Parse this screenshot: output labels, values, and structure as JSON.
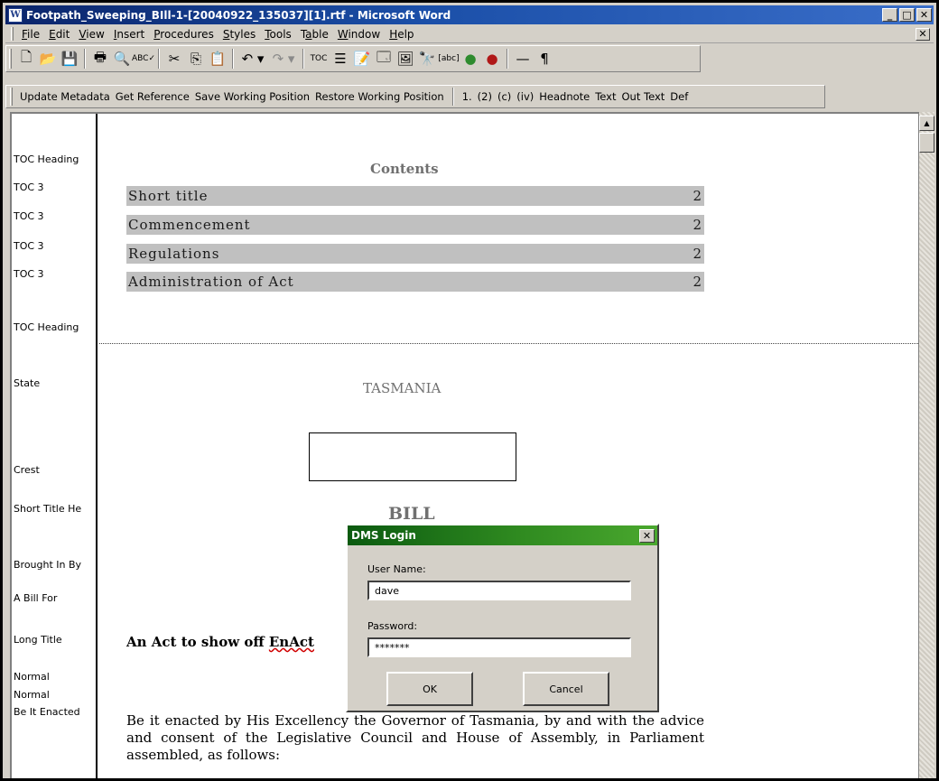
{
  "window": {
    "title": "Footpath_Sweeping_BIll-1-[20040922_135037][1].rtf - Microsoft Word",
    "app_icon": "W",
    "controls": {
      "minimize": "_",
      "maximize": "□",
      "close": "✕"
    },
    "doc_close": "✕"
  },
  "menu": [
    {
      "key": "F",
      "rest": "ile"
    },
    {
      "key": "E",
      "rest": "dit"
    },
    {
      "key": "V",
      "rest": "iew"
    },
    {
      "key": "I",
      "rest": "nsert"
    },
    {
      "key": "P",
      "rest": "rocedures"
    },
    {
      "key": "S",
      "rest": "tyles"
    },
    {
      "key": "T",
      "rest": "ools"
    },
    {
      "pre": "T",
      "key": "a",
      "rest": "ble"
    },
    {
      "key": "W",
      "rest": "indow"
    },
    {
      "key": "H",
      "rest": "elp"
    }
  ],
  "toolbar": {
    "icons": {
      "new": "🗋",
      "open": "📂",
      "save": "💾",
      "print": "🖶",
      "preview": "🔍",
      "spelling": "ABC✓",
      "cut": "✂",
      "copy": "⎘",
      "paste": "📋",
      "undo": "↶ ▾",
      "redo": "↷ ▾",
      "toc": "TOC",
      "bullets": "☰",
      "fields": "📝",
      "metadata": "🗔",
      "image": "🖼",
      "binoculars": "🔭",
      "abc_field": "[abc]",
      "comment_green": "●",
      "comment_red": "●",
      "rule": "—",
      "pilcrow": "¶"
    }
  },
  "custom_toolbar": {
    "buttons": [
      "Update Metadata",
      "Get Reference",
      "Save Working Position",
      "Restore Working Position"
    ],
    "format_buttons": [
      "1.",
      "(2)",
      "(c)",
      "(iv)",
      "Headnote",
      "Text",
      "Out Text",
      "Def"
    ]
  },
  "style_labels": [
    "TOC Heading",
    "TOC 3",
    "TOC 3",
    "TOC 3",
    "TOC 3",
    "TOC Heading",
    "State",
    "Crest",
    "Short Title He",
    "Brought In By",
    "A Bill For",
    "Long Title",
    "Normal",
    "Normal",
    "Be It Enacted"
  ],
  "document": {
    "contents_heading": "Contents",
    "toc": [
      {
        "title": "Short title",
        "page": "2"
      },
      {
        "title": "Commencement",
        "page": "2"
      },
      {
        "title": "Regulations",
        "page": "2"
      },
      {
        "title": "Administration of Act",
        "page": "2"
      }
    ],
    "state": "TASMANIA",
    "bill": "BILL",
    "long_title_prefix": "An Act to show off ",
    "long_title_word": "EnAct",
    "enacting_text": "Be it enacted by His Excellency the Governor of Tasmania, by and with the advice and consent of the Legislative Council and House of Assembly, in Parliament assembled, as follows:"
  },
  "dialog": {
    "title": "DMS Login",
    "close": "✕",
    "username_label": "User Name:",
    "username_value": "dave",
    "password_label": "Password:",
    "password_value": "*******",
    "ok": "OK",
    "cancel": "Cancel"
  },
  "colors": {
    "titlebar": "#0a246a",
    "dialog_titlebar": "#2f8a20",
    "toc_highlight": "#c0c0c0",
    "chrome": "#d4d0c8"
  }
}
